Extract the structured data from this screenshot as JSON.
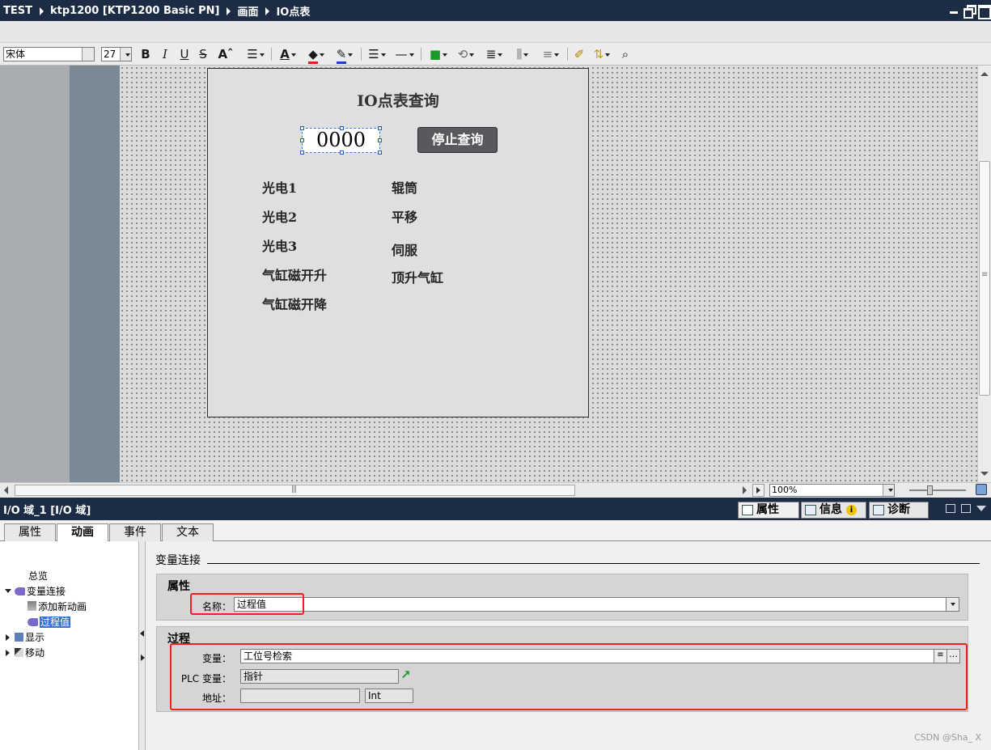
{
  "window": {
    "breadcrumb": [
      "TEST",
      "ktp1200 [KTP1200 Basic PN]",
      "画面",
      "IO点表"
    ]
  },
  "toolbar": {
    "font_name": "宋体",
    "font_size": "27",
    "bold": "B",
    "italic": "I",
    "underline": "U",
    "strike": "S",
    "grow": "Aˆ"
  },
  "zoom": {
    "value": "100%"
  },
  "hmi": {
    "title": "IO点表查询",
    "io_value": "0000",
    "stop_button": "停止查询",
    "labels_left": [
      "光电1",
      "光电2",
      "光电3",
      "气缸磁开升",
      "气缸磁开降"
    ],
    "labels_right": [
      "辊筒",
      "平移",
      "伺服",
      "顶升气缸"
    ]
  },
  "inspector": {
    "object_title": "I/O 域_1 [I/O 域]",
    "tabs": [
      "属性",
      "信息",
      "诊断"
    ],
    "subtabs": [
      "属性",
      "动画",
      "事件",
      "文本"
    ],
    "tree": {
      "overview": "总览",
      "tag_connection": "变量连接",
      "add_animation": "添加新动画",
      "process_value": "过程值",
      "display": "显示",
      "move": "移动"
    },
    "content": {
      "section_title": "变量连接",
      "props_group": "属性",
      "name_label": "名称：",
      "name_value": "过程值",
      "process_group": "过程",
      "tag_label": "变量：",
      "tag_value": "工位号检索",
      "plc_tag_label": "PLC 变量：",
      "plc_tag_value": "指针",
      "address_label": "地址：",
      "address_value": "",
      "address_type": "Int"
    }
  },
  "watermark": "CSDN @Sha_ X",
  "colors": {
    "titlebar": "#1c2c45",
    "highlight_red": "#e8231f",
    "selection_blue": "#3473c8"
  }
}
